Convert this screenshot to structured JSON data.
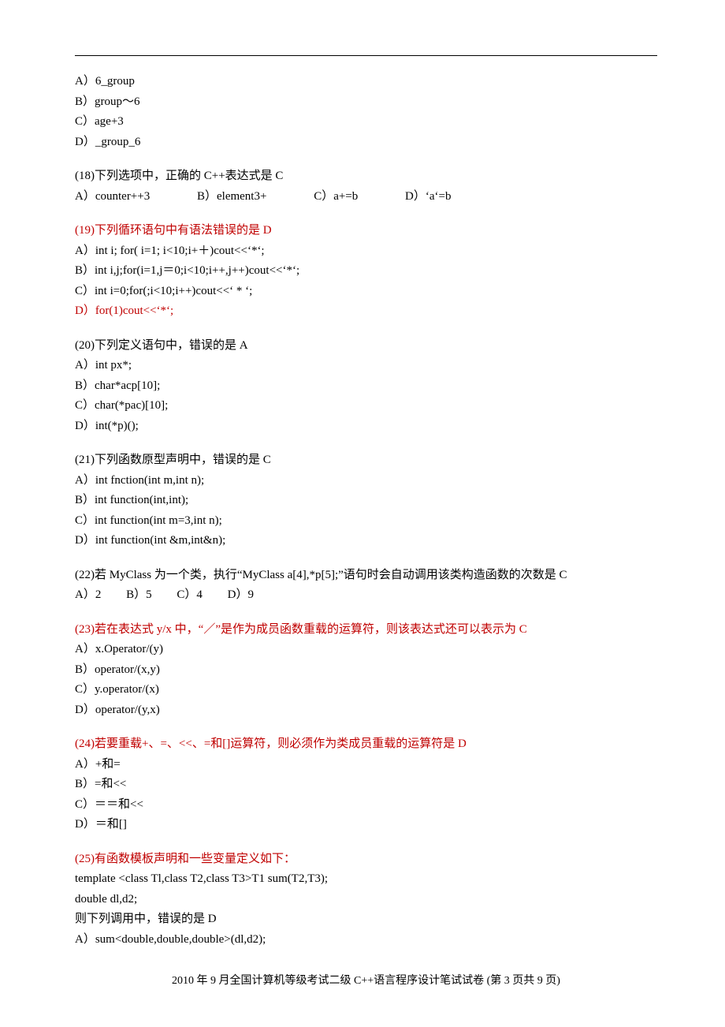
{
  "q17_opts": {
    "a": "A）6_group",
    "b": "B）group～6",
    "c": "C）age+3",
    "d": "D）_group_6"
  },
  "q18": {
    "stem": "(18)下列选项中，正确的 C++表达式是  C",
    "a": "A）counter++3",
    "b": "B）element3+",
    "c": "C）a+=b",
    "d": "D）‘a‘=b"
  },
  "q19": {
    "stem": "(19)下列循环语句中有语法错误的是  D",
    "a": "A）int i; for( i=1; i<10;i+＋)cout<<‘*‘;",
    "b": "B）int i,j;for(i=1,j＝0;i<10;i++,j++)cout<<‘*‘;",
    "c": "C）int i=0;for(;i<10;i++)cout<<‘ * ‘;",
    "d": "D）for(1)cout<<‘*‘;"
  },
  "q20": {
    "stem": "(20)下列定义语句中，错误的是  A",
    "a": "A）int px*;",
    "b": "B）char*acp[10];",
    "c": "C）char(*pac)[10];",
    "d": "D）int(*p)();"
  },
  "q21": {
    "stem": "(21)下列函数原型声明中，错误的是  C",
    "a": "A）int fnction(int m,int n);",
    "b": "B）int function(int,int);",
    "c": "C）int function(int m=3,int n);",
    "d": "D）int function(int &m,int&n);"
  },
  "q22": {
    "stem": "(22)若 MyClass 为一个类，执行“MyClass a[4],*p[5];”语句时会自动调用该类构造函数的次数是  C",
    "a": "A）2",
    "b": "B）5",
    "c": "C）4",
    "d": "D）9"
  },
  "q23": {
    "stem": "(23)若在表达式 y/x 中，“／”是作为成员函数重载的运算符，则该表达式还可以表示为 C",
    "a": "A）x.Operator/(y)",
    "b": "B）operator/(x,y)",
    "c": "C）y.operator/(x)",
    "d": "D）operator/(y,x)"
  },
  "q24": {
    "stem": "(24)若要重载+、=、<<、=和[]运算符，则必须作为类成员重载的运算符是  D",
    "a": "A）+和=",
    "b": "B）=和<<",
    "c": "C）＝＝和<<",
    "d": "D）＝和[]"
  },
  "q25": {
    "stem": "(25)有函数模板声明和一些变量定义如下：",
    "l1": "template <class Tl,class T2,class T3>T1 sum(T2,T3);",
    "l2": "double dl,d2;",
    "l3": "则下列调用中，错误的是    D",
    "a": "A）sum<double,double,double>(dl,d2);"
  },
  "footer": "2010 年 9 月全国计算机等级考试二级 C++语言程序设计笔试试卷    (第 3 页共 9 页)"
}
